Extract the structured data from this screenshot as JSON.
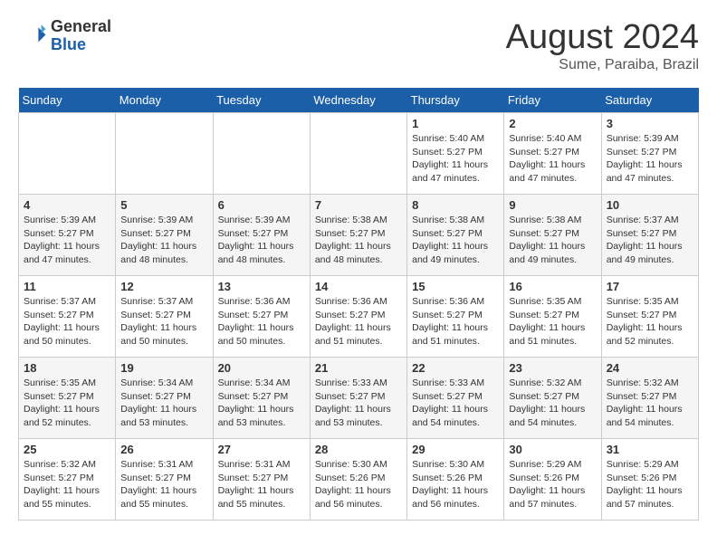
{
  "header": {
    "logo_line1": "General",
    "logo_line2": "Blue",
    "main_title": "August 2024",
    "subtitle": "Sume, Paraiba, Brazil"
  },
  "weekdays": [
    "Sunday",
    "Monday",
    "Tuesday",
    "Wednesday",
    "Thursday",
    "Friday",
    "Saturday"
  ],
  "weeks": [
    [
      {
        "day": "",
        "info": ""
      },
      {
        "day": "",
        "info": ""
      },
      {
        "day": "",
        "info": ""
      },
      {
        "day": "",
        "info": ""
      },
      {
        "day": "1",
        "info": "Sunrise: 5:40 AM\nSunset: 5:27 PM\nDaylight: 11 hours\nand 47 minutes."
      },
      {
        "day": "2",
        "info": "Sunrise: 5:40 AM\nSunset: 5:27 PM\nDaylight: 11 hours\nand 47 minutes."
      },
      {
        "day": "3",
        "info": "Sunrise: 5:39 AM\nSunset: 5:27 PM\nDaylight: 11 hours\nand 47 minutes."
      }
    ],
    [
      {
        "day": "4",
        "info": "Sunrise: 5:39 AM\nSunset: 5:27 PM\nDaylight: 11 hours\nand 47 minutes."
      },
      {
        "day": "5",
        "info": "Sunrise: 5:39 AM\nSunset: 5:27 PM\nDaylight: 11 hours\nand 48 minutes."
      },
      {
        "day": "6",
        "info": "Sunrise: 5:39 AM\nSunset: 5:27 PM\nDaylight: 11 hours\nand 48 minutes."
      },
      {
        "day": "7",
        "info": "Sunrise: 5:38 AM\nSunset: 5:27 PM\nDaylight: 11 hours\nand 48 minutes."
      },
      {
        "day": "8",
        "info": "Sunrise: 5:38 AM\nSunset: 5:27 PM\nDaylight: 11 hours\nand 49 minutes."
      },
      {
        "day": "9",
        "info": "Sunrise: 5:38 AM\nSunset: 5:27 PM\nDaylight: 11 hours\nand 49 minutes."
      },
      {
        "day": "10",
        "info": "Sunrise: 5:37 AM\nSunset: 5:27 PM\nDaylight: 11 hours\nand 49 minutes."
      }
    ],
    [
      {
        "day": "11",
        "info": "Sunrise: 5:37 AM\nSunset: 5:27 PM\nDaylight: 11 hours\nand 50 minutes."
      },
      {
        "day": "12",
        "info": "Sunrise: 5:37 AM\nSunset: 5:27 PM\nDaylight: 11 hours\nand 50 minutes."
      },
      {
        "day": "13",
        "info": "Sunrise: 5:36 AM\nSunset: 5:27 PM\nDaylight: 11 hours\nand 50 minutes."
      },
      {
        "day": "14",
        "info": "Sunrise: 5:36 AM\nSunset: 5:27 PM\nDaylight: 11 hours\nand 51 minutes."
      },
      {
        "day": "15",
        "info": "Sunrise: 5:36 AM\nSunset: 5:27 PM\nDaylight: 11 hours\nand 51 minutes."
      },
      {
        "day": "16",
        "info": "Sunrise: 5:35 AM\nSunset: 5:27 PM\nDaylight: 11 hours\nand 51 minutes."
      },
      {
        "day": "17",
        "info": "Sunrise: 5:35 AM\nSunset: 5:27 PM\nDaylight: 11 hours\nand 52 minutes."
      }
    ],
    [
      {
        "day": "18",
        "info": "Sunrise: 5:35 AM\nSunset: 5:27 PM\nDaylight: 11 hours\nand 52 minutes."
      },
      {
        "day": "19",
        "info": "Sunrise: 5:34 AM\nSunset: 5:27 PM\nDaylight: 11 hours\nand 53 minutes."
      },
      {
        "day": "20",
        "info": "Sunrise: 5:34 AM\nSunset: 5:27 PM\nDaylight: 11 hours\nand 53 minutes."
      },
      {
        "day": "21",
        "info": "Sunrise: 5:33 AM\nSunset: 5:27 PM\nDaylight: 11 hours\nand 53 minutes."
      },
      {
        "day": "22",
        "info": "Sunrise: 5:33 AM\nSunset: 5:27 PM\nDaylight: 11 hours\nand 54 minutes."
      },
      {
        "day": "23",
        "info": "Sunrise: 5:32 AM\nSunset: 5:27 PM\nDaylight: 11 hours\nand 54 minutes."
      },
      {
        "day": "24",
        "info": "Sunrise: 5:32 AM\nSunset: 5:27 PM\nDaylight: 11 hours\nand 54 minutes."
      }
    ],
    [
      {
        "day": "25",
        "info": "Sunrise: 5:32 AM\nSunset: 5:27 PM\nDaylight: 11 hours\nand 55 minutes."
      },
      {
        "day": "26",
        "info": "Sunrise: 5:31 AM\nSunset: 5:27 PM\nDaylight: 11 hours\nand 55 minutes."
      },
      {
        "day": "27",
        "info": "Sunrise: 5:31 AM\nSunset: 5:27 PM\nDaylight: 11 hours\nand 55 minutes."
      },
      {
        "day": "28",
        "info": "Sunrise: 5:30 AM\nSunset: 5:26 PM\nDaylight: 11 hours\nand 56 minutes."
      },
      {
        "day": "29",
        "info": "Sunrise: 5:30 AM\nSunset: 5:26 PM\nDaylight: 11 hours\nand 56 minutes."
      },
      {
        "day": "30",
        "info": "Sunrise: 5:29 AM\nSunset: 5:26 PM\nDaylight: 11 hours\nand 57 minutes."
      },
      {
        "day": "31",
        "info": "Sunrise: 5:29 AM\nSunset: 5:26 PM\nDaylight: 11 hours\nand 57 minutes."
      }
    ]
  ]
}
